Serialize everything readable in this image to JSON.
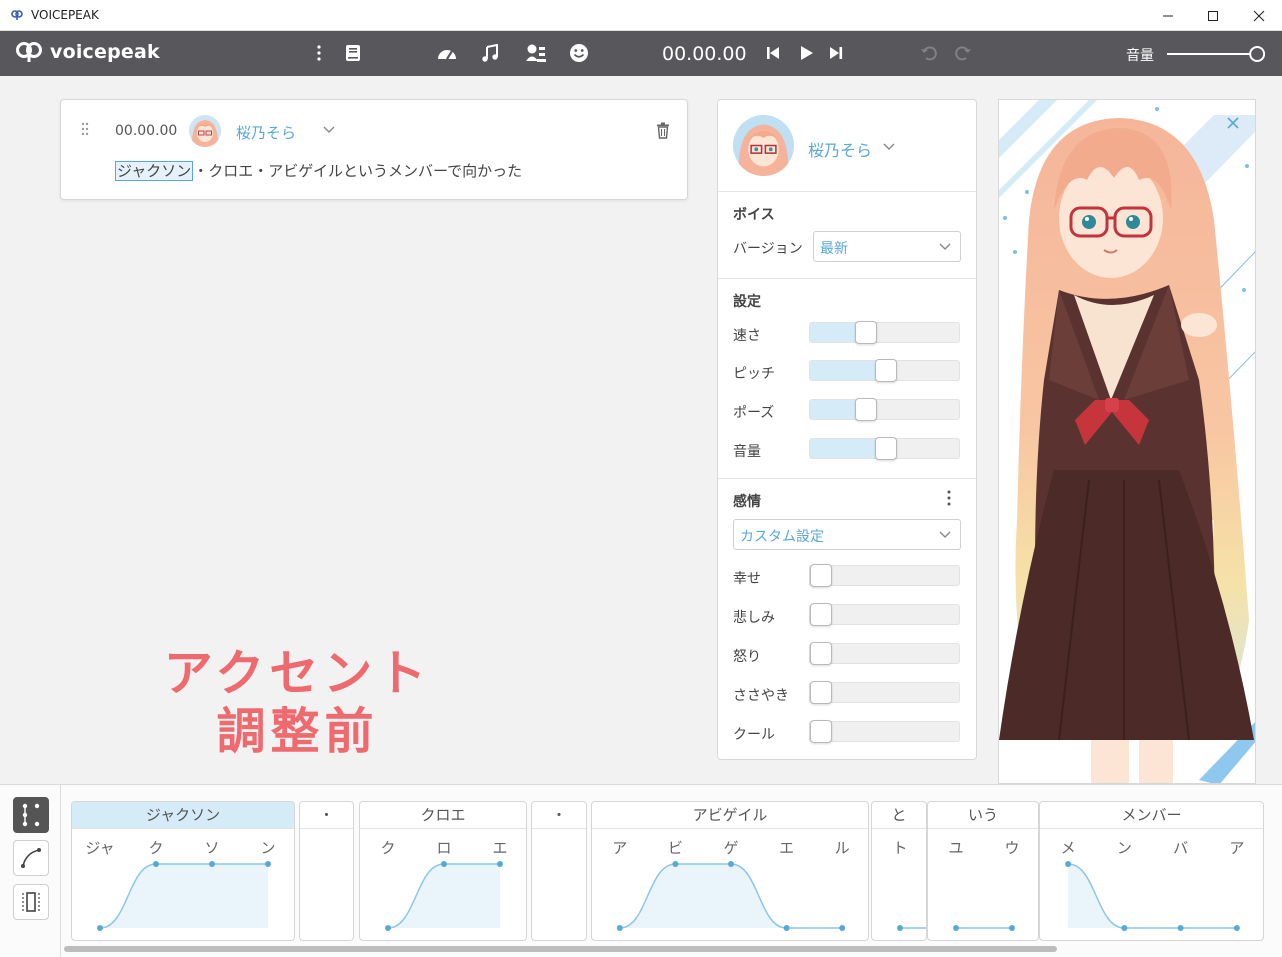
{
  "window": {
    "title": "VOICEPEAK"
  },
  "toolbar": {
    "logo_text": "voicepeak",
    "timecode": "00.00.00",
    "volume_label": "音量",
    "volume_level": 0.92
  },
  "block": {
    "time": "00.00.00",
    "character": "桜乃そら",
    "selected_word": "ジャクソン",
    "rest_text": "・クロエ・アビゲイルというメンバーで向かった"
  },
  "annotation": {
    "line1": "アクセント",
    "line2": "調整前"
  },
  "panel": {
    "character": "桜乃そら",
    "voice_title": "ボイス",
    "version_label": "バージョン",
    "version_value": "最新",
    "settings_title": "設定",
    "settings": [
      {
        "label": "速さ",
        "value": 0.35
      },
      {
        "label": "ピッチ",
        "value": 0.5
      },
      {
        "label": "ポーズ",
        "value": 0.35
      },
      {
        "label": "音量",
        "value": 0.5
      }
    ],
    "emotion_title": "感情",
    "emotion_preset": "カスタム設定",
    "emotions": [
      {
        "label": "幸せ",
        "value": 0
      },
      {
        "label": "悲しみ",
        "value": 0
      },
      {
        "label": "怒り",
        "value": 0
      },
      {
        "label": "ささやき",
        "value": 0
      },
      {
        "label": "クール",
        "value": 0
      }
    ]
  },
  "accent_editor": {
    "words": [
      {
        "text": "ジャクソン",
        "morae": [
          "ジャ",
          "ク",
          "ソ",
          "ン"
        ],
        "pitch": [
          0,
          1,
          1,
          1
        ],
        "selected": true
      },
      {
        "text": "・",
        "morae": [],
        "pitch": []
      },
      {
        "text": "クロエ",
        "morae": [
          "ク",
          "ロ",
          "エ"
        ],
        "pitch": [
          0,
          1,
          1
        ]
      },
      {
        "text": "・",
        "morae": [],
        "pitch": []
      },
      {
        "text": "アビゲイル",
        "morae": [
          "ア",
          "ビ",
          "ゲ",
          "エ",
          "ル"
        ],
        "pitch": [
          0,
          1,
          1,
          0,
          0
        ]
      },
      {
        "text": "と",
        "morae": [
          "ト"
        ],
        "pitch": [
          0
        ]
      },
      {
        "text": "いう",
        "morae": [
          "ユ",
          "ウ"
        ],
        "pitch": [
          0,
          0
        ]
      },
      {
        "text": "メンバー",
        "morae": [
          "メ",
          "ン",
          "バ",
          "ア"
        ],
        "pitch": [
          1,
          0,
          0,
          0
        ]
      }
    ]
  },
  "colors": {
    "accent_blue": "#5aa8d8",
    "toolbar_bg": "#58585c",
    "annotation_red": "#ee6a6e",
    "selection_bg": "#d6ebf8"
  }
}
